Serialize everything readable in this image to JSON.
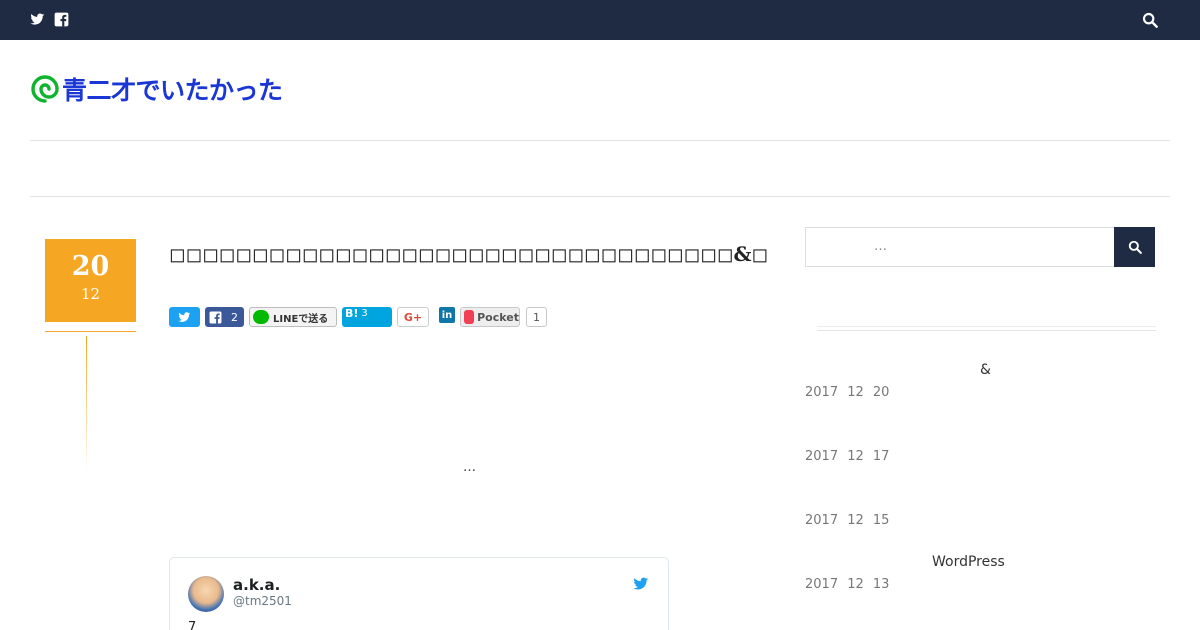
{
  "topbar": {
    "icons": [
      "twitter-icon",
      "facebook-icon",
      "search-icon"
    ]
  },
  "site": {
    "logo_text": "青二才でいたかった"
  },
  "post": {
    "date_day": "20",
    "date_month": "12",
    "title": "◻◻◻◻◻◻◻◻◻◻◻◻◻◻◻◻◻◻◻◻◻◻◻◻◻◻◻◻◻◻◻◻◻◻&◻◻◻◻◻◻◻◻◻◻◻◻◻◻◻◻◻◻◻",
    "excerpt_ellipsis": "…"
  },
  "share": {
    "facebook_count": "2",
    "line_label": "LINEで送る",
    "hatena_label": "B!",
    "hatena_count": "3",
    "googleplus_label": "G+",
    "linkedin_label": "in",
    "pocket_label": "Pocket",
    "pocket_count": "1"
  },
  "tweet": {
    "name": "a.k.a.",
    "handle": "@tm2501",
    "text": "7"
  },
  "sidebar": {
    "search_placeholder": "…",
    "recent_posts": [
      {
        "title": "&",
        "date": "2017 12 20"
      },
      {
        "title": "",
        "date": "2017 12 17"
      },
      {
        "title": "",
        "date": "2017 12 15"
      },
      {
        "title": "WordPress",
        "date": "2017 12 13"
      }
    ]
  },
  "colors": {
    "topbar": "#1e2b42",
    "accent": "#f5a623",
    "logo": "#1a37d6",
    "twitter": "#1da1f2",
    "facebook": "#3b5998",
    "hatena": "#00a4de"
  }
}
